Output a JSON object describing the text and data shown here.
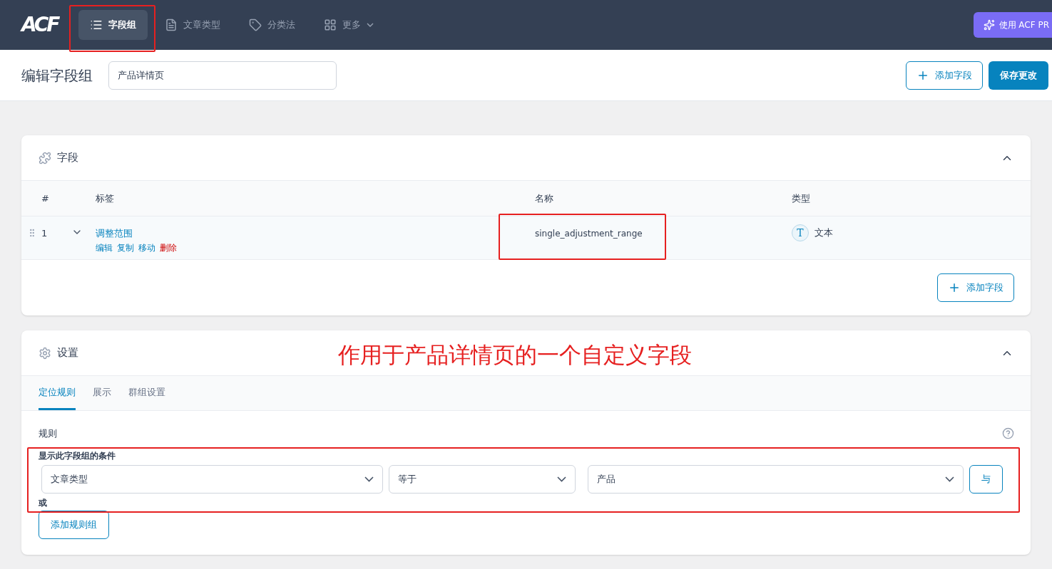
{
  "nav": {
    "logo": "ACF",
    "items": [
      {
        "label": "字段组",
        "selected": true
      },
      {
        "label": "文章类型",
        "selected": false
      },
      {
        "label": "分类法",
        "selected": false
      },
      {
        "label": "更多",
        "selected": false,
        "dropdown": true
      }
    ],
    "pro_button": "使用 ACF PR"
  },
  "header": {
    "title": "编辑字段组",
    "name_value": "产品详情页",
    "add_field_button": "添加字段",
    "save_button": "保存更改"
  },
  "fields_panel": {
    "title": "字段",
    "columns": [
      "#",
      "标签",
      "名称",
      "类型"
    ],
    "rows": [
      {
        "number": "1",
        "label": "调整范围",
        "actions": [
          {
            "label": "编辑",
            "kind": "normal"
          },
          {
            "label": "复制",
            "kind": "normal"
          },
          {
            "label": "移动",
            "kind": "normal"
          },
          {
            "label": "删除",
            "kind": "danger"
          }
        ],
        "name": "single_adjustment_range",
        "type_icon": "T",
        "type": "文本"
      }
    ],
    "add_field_button": "添加字段"
  },
  "settings_panel": {
    "title": "设置",
    "tabs": [
      {
        "label": "定位规则",
        "selected": true
      },
      {
        "label": "展示",
        "selected": false
      },
      {
        "label": "群组设置",
        "selected": false
      }
    ],
    "rules_label": "规则",
    "condition_title": "显示此字段组的条件",
    "rule": {
      "param": "文章类型",
      "operator": "等于",
      "value": "产品"
    },
    "and_button": "与",
    "or_label": "或",
    "add_group_button": "添加规则组"
  },
  "annotation": {
    "text": "作用于产品详情页的一个自定义字段"
  }
}
